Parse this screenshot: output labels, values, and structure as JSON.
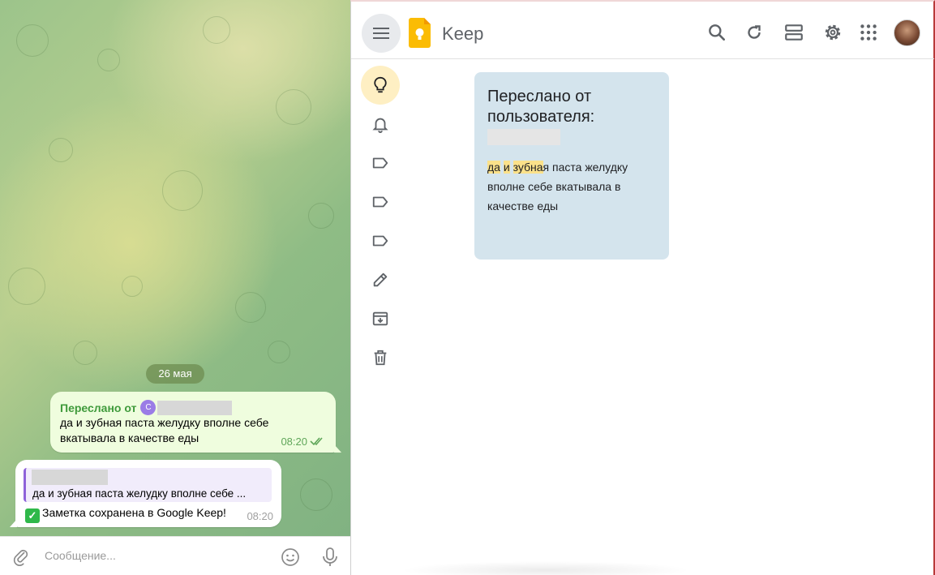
{
  "telegram": {
    "date_label": "26 мая",
    "forwarded_message": {
      "forward_prefix": "Переслано от",
      "avatar_initial": "С",
      "text": "да и зубная паста желудку вполне себе вкатывала в качестве еды",
      "time": "08:20"
    },
    "bot_reply": {
      "quoted_text": "да и зубная паста желудку вполне себе ...",
      "text": "Заметка сохранена в Google Keep!",
      "time": "08:20"
    },
    "composer": {
      "placeholder": "Сообщение..."
    }
  },
  "keep": {
    "app_title": "Keep",
    "header_icons": [
      "menu-icon",
      "search-icon",
      "refresh-icon",
      "list-view-icon",
      "settings-icon",
      "apps-icon",
      "account-avatar"
    ],
    "sidebar_icons": [
      "lightbulb-icon",
      "bell-icon",
      "label-icon",
      "label-icon",
      "label-icon",
      "pencil-icon",
      "archive-icon",
      "trash-icon"
    ],
    "note": {
      "title": "Переслано от пользователя:",
      "body_highlight_1": "да",
      "body_highlight_2": "и",
      "body_highlight_3": "зубна",
      "body_rest": "я паста желудку вполне себе вкатывала в качестве еды",
      "color": "#d4e4ed"
    }
  }
}
